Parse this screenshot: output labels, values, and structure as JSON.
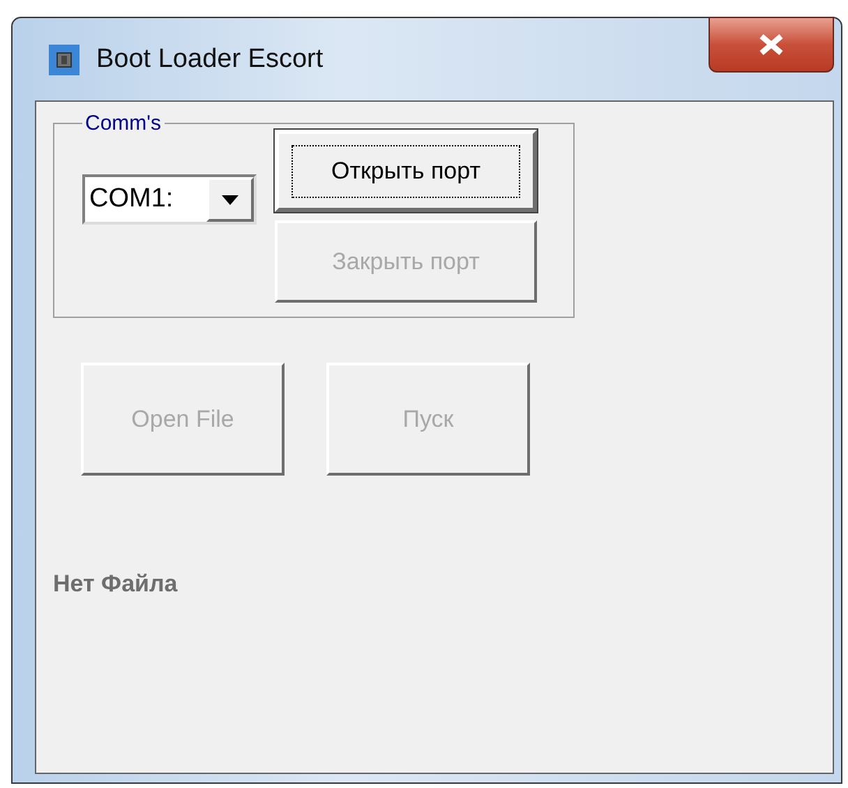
{
  "window": {
    "title": "Boot Loader Escort"
  },
  "comms": {
    "title": "Comm's",
    "port": {
      "value": "COM1:"
    },
    "buttons": [
      {
        "label": "Открыть порт",
        "disabled": false,
        "focused": true
      },
      {
        "label": "Закрыть порт",
        "disabled": true,
        "focused": false
      }
    ]
  },
  "actions": [
    {
      "label": "Open File",
      "disabled": true
    },
    {
      "label": "Пуск",
      "disabled": true
    }
  ],
  "status": "Нет Файла"
}
